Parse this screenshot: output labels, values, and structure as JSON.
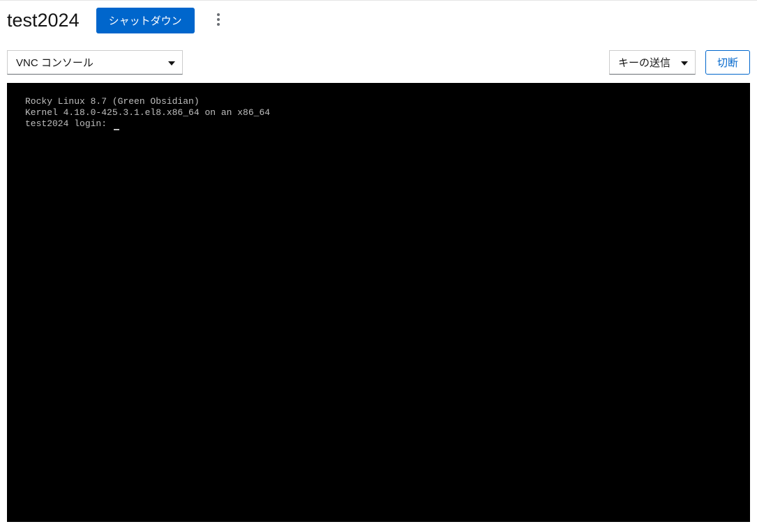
{
  "header": {
    "title": "test2024",
    "shutdown_label": "シャットダウン"
  },
  "toolbar": {
    "console_type": "VNC コンソール",
    "send_key_label": "キーの送信",
    "disconnect_label": "切断"
  },
  "console": {
    "line1": "Rocky Linux 8.7 (Green Obsidian)",
    "line2": "Kernel 4.18.0-425.3.1.el8.x86_64 on an x86_64",
    "line3": "",
    "line4": "test2024 login: "
  }
}
